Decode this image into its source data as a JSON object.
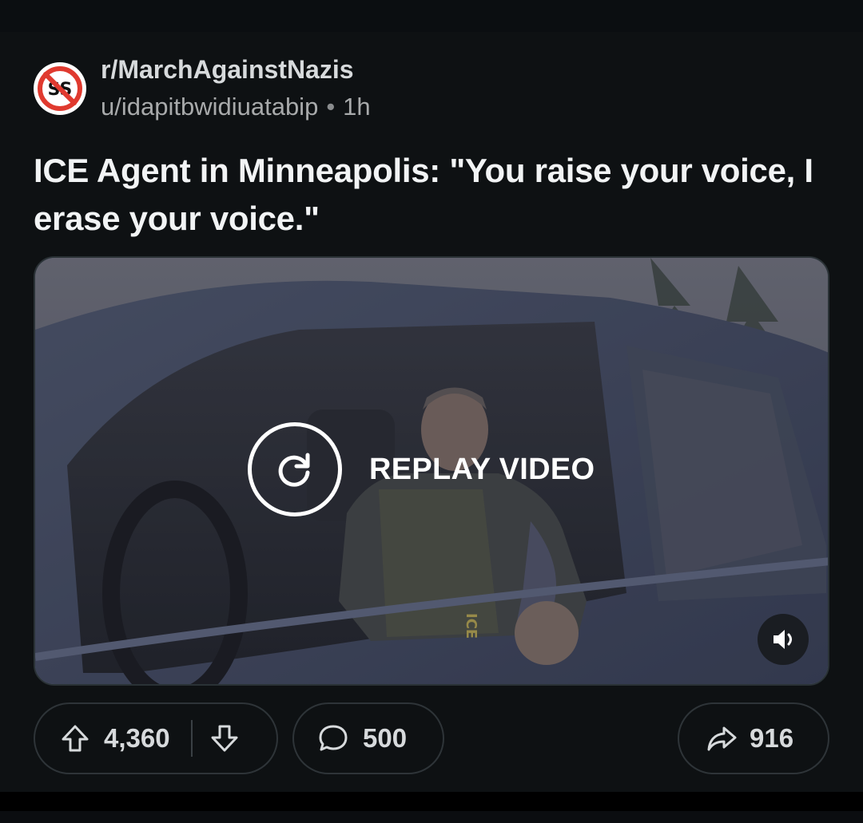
{
  "post": {
    "subreddit": "r/MarchAgainstNazis",
    "user": "u/idapitbwidiuatabip",
    "separator": "•",
    "age": "1h",
    "title": "ICE Agent in Minneapolis: \"You raise your voice, I erase your voice.\""
  },
  "media": {
    "replay_label": "REPLAY VIDEO",
    "replay_icon": "replay-icon",
    "audio_icon": "speaker-muted-icon",
    "vest_text": "ICE"
  },
  "actions": {
    "upvotes": "4,360",
    "comments": "500",
    "shares": "916",
    "upvote_icon": "arrow-up-icon",
    "downvote_icon": "arrow-down-icon",
    "comment_icon": "comment-bubble-icon",
    "share_icon": "share-arrow-icon"
  },
  "colors": {
    "background": "#0e1113",
    "subreddit_text": "#d7dadc",
    "secondary_text": "#a8aaab",
    "title_text": "#f2f4f5",
    "pill_border": "#2e3438",
    "avatar_red": "#e03a2f"
  }
}
